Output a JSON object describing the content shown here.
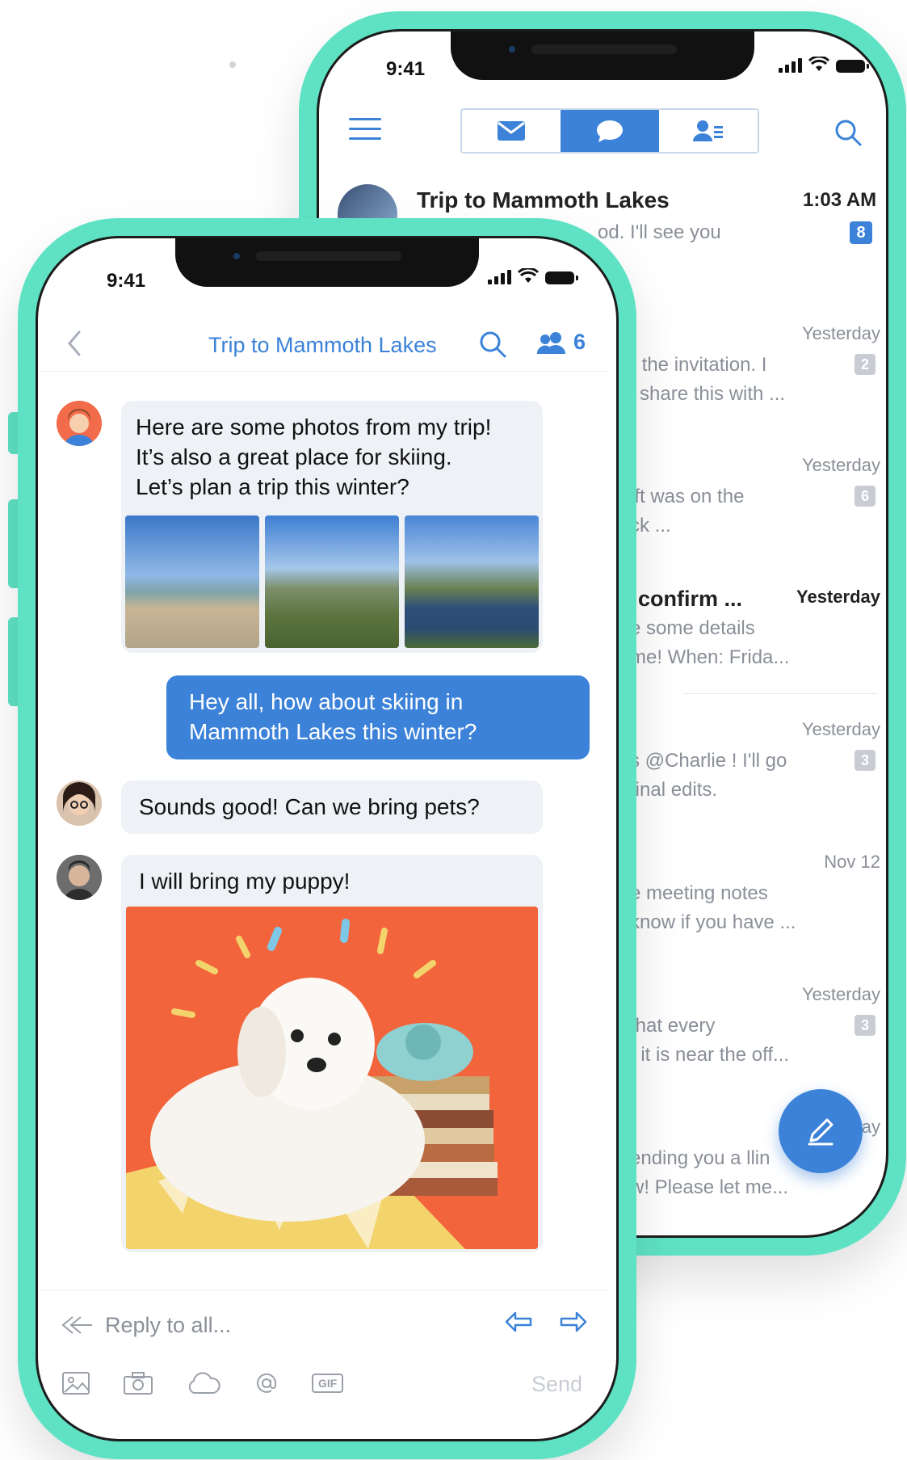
{
  "back_phone": {
    "status_time": "9:41",
    "tabs": [
      {
        "icon": "mail-icon"
      },
      {
        "icon": "chat-bubble-icon",
        "active": true
      },
      {
        "icon": "contacts-icon"
      }
    ],
    "first_row": {
      "subject": "Trip to Mammoth Lakes",
      "time": "1:03 AM",
      "preview": "od. I'll see you",
      "badge": "8"
    },
    "rows": [
      {
        "time": "Yesterday",
        "line1": "r the invitation. I",
        "line2": "l share this with ...",
        "badge": "2"
      },
      {
        "time": "Yesterday",
        "line1": "ift was on the",
        "line2": "ck ...",
        "badge": "6"
      },
      {
        "time": "Yesterday",
        "subject": "confirm ...",
        "line1": "e some details",
        "line2": "me! When: Frida..."
      },
      {
        "time": "Yesterday",
        "line1": "s @Charlie ! I'll go",
        "line2": "final edits.",
        "badge": "3"
      },
      {
        "time": "Nov 12",
        "line1": "e meeting notes",
        "line2": "know if you have ..."
      },
      {
        "time": "Yesterday",
        "line1": "that every",
        "line2": ", it is near the off...",
        "badge": "3"
      },
      {
        "time": "ay",
        "line1": "ending you a llin",
        "line2": "w! Please let me..."
      }
    ]
  },
  "front_phone": {
    "status_time": "9:41",
    "header": {
      "title": "Trip to Mammoth Lakes",
      "member_count": "6"
    },
    "messages": [
      {
        "sender": "avatar-red-person",
        "text": [
          "Here are some photos from my trip!",
          "It’s also a great place for skiing.",
          "Let’s plan a trip this winter?"
        ]
      },
      {
        "sender": "self",
        "text": [
          "Hey all, how about skiing in",
          "Mammoth Lakes this winter?"
        ]
      },
      {
        "sender": "avatar-woman-glasses",
        "text": [
          "Sounds good! Can we bring pets?"
        ]
      },
      {
        "sender": "avatar-man",
        "text": [
          "I will bring my puppy!"
        ]
      }
    ],
    "composer": {
      "placeholder": "Reply to all...",
      "send_label": "Send",
      "gif_label": "GIF"
    }
  },
  "colors": {
    "accent": "#3b82d8",
    "phone_frame": "#5fe2c4",
    "bubble_in": "#eef1f5",
    "photo_background_orange": "#f2643c"
  }
}
